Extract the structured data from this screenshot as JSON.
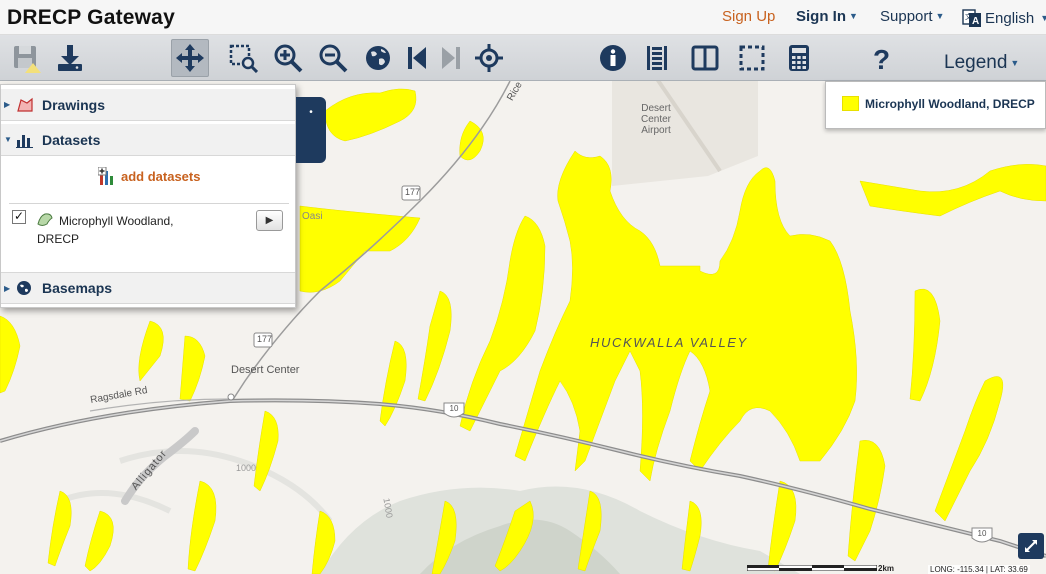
{
  "header": {
    "title": "DRECP Gateway",
    "sign_up": "Sign Up",
    "sign_in": "Sign In",
    "support": "Support",
    "language": "English"
  },
  "toolbar": {
    "legend_label": "Legend",
    "tools": [
      "save-icon",
      "download-icon",
      "pan-icon",
      "zoom-to-box-icon",
      "zoom-in-icon",
      "zoom-out-icon",
      "full-extent-icon",
      "previous-extent-icon",
      "next-extent-icon",
      "locate-icon",
      "identify-icon",
      "attribute-table-icon",
      "compare-icon",
      "select-icon",
      "calculator-icon",
      "help-icon"
    ]
  },
  "panel": {
    "drawings_label": "Drawings",
    "datasets_label": "Datasets",
    "add_datasets_label": "add datasets",
    "dataset_name": "Microphyll Woodland, DRECP",
    "dataset_checked": true,
    "basemaps_label": "Basemaps"
  },
  "legend": {
    "entry_label": "Microphyll Woodland, DRECP",
    "swatch_color": "#ffff00"
  },
  "map": {
    "labels": {
      "valley": "HUCKWALLA VALLEY",
      "airport": "Desert Center Airport",
      "town": "Desert Center",
      "road_ragsdale": "Ragsdale Rd",
      "road_rice": "Rice",
      "alligator": "Alligator",
      "oasis": "Oasi",
      "hwy177_a": "177",
      "hwy177_b": "177",
      "i10_a": "10",
      "i10_b": "10",
      "elev_1000": "1000",
      "elev_1000_b": "1000"
    },
    "scale_label": "2km",
    "coordinates": "LONG: -115.34 | LAT: 33.69"
  },
  "colors": {
    "accent": "#c8621f",
    "navy": "#1b3553",
    "woodland": "#ffff00"
  }
}
